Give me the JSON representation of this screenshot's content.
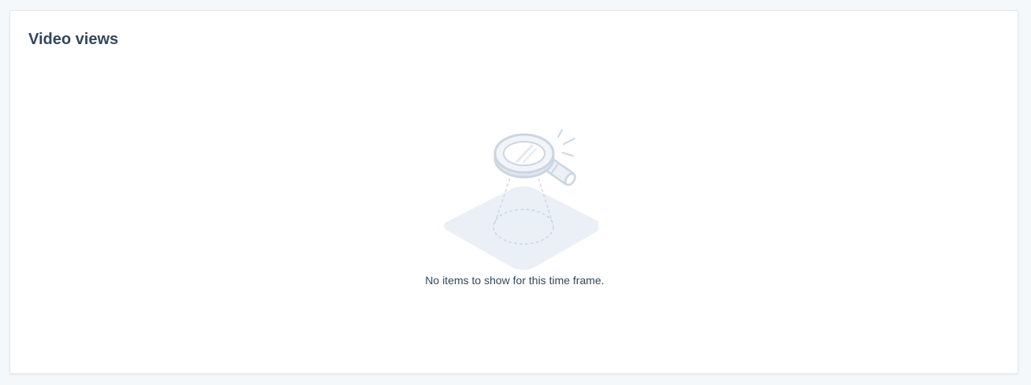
{
  "card": {
    "title": "Video views",
    "empty_state": {
      "message": "No items to show for this time frame.",
      "illustration_icon": "magnifying-glass-spotlight-icon"
    }
  },
  "colors": {
    "page_background": "#f5f8fa",
    "card_background": "#ffffff",
    "text": "#33475b",
    "illustration_fill": "#eaf0f6",
    "illustration_stroke": "#cbd6e2"
  }
}
